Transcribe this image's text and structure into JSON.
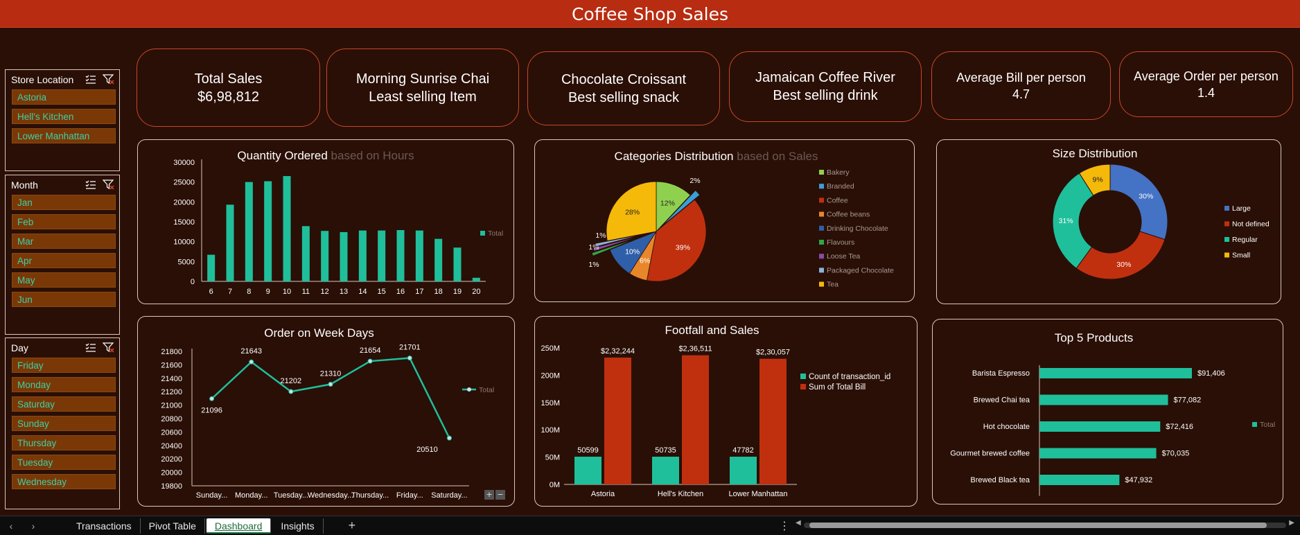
{
  "title": "Coffee Shop Sales",
  "slicers": {
    "store": {
      "label": "Store Location",
      "items": [
        "Astoria",
        "Hell's Kitchen",
        "Lower Manhattan"
      ]
    },
    "month": {
      "label": "Month",
      "items": [
        "Jan",
        "Feb",
        "Mar",
        "Apr",
        "May",
        "Jun"
      ]
    },
    "day": {
      "label": "Day",
      "items": [
        "Friday",
        "Monday",
        "Saturday",
        "Sunday",
        "Thursday",
        "Tuesday",
        "Wednesday"
      ]
    }
  },
  "kpis": {
    "total_sales": {
      "line1": "Total Sales",
      "line2": "$6,98,812"
    },
    "least_item": {
      "line1": "Morning Sunrise Chai",
      "line2": "Least selling Item"
    },
    "best_snack": {
      "line1": "Chocolate Croissant",
      "line2": "Best selling snack"
    },
    "best_drink": {
      "line1": "Jamaican Coffee River",
      "line2": "Best selling drink"
    },
    "avg_bill": {
      "line1": "Average Bill per person",
      "line2": "4.7"
    },
    "avg_order": {
      "line1": "Average Order per person",
      "line2": "1.4"
    }
  },
  "colors": {
    "teal": "#1fbf9b",
    "red": "#c0300f",
    "bg": "#2a0f06",
    "header": "#b82c11"
  },
  "chart_data": [
    {
      "id": "qty_hours",
      "type": "bar",
      "title": "Quantity Ordered",
      "subtitle": "based on Hours",
      "categories": [
        "6",
        "7",
        "8",
        "9",
        "10",
        "11",
        "12",
        "13",
        "14",
        "15",
        "16",
        "17",
        "18",
        "19",
        "20"
      ],
      "series": [
        {
          "name": "Total",
          "values": [
            6700,
            19300,
            25000,
            25200,
            26500,
            13900,
            12700,
            12400,
            12800,
            12800,
            12900,
            12800,
            10700,
            8500,
            900
          ]
        }
      ],
      "yticks": [
        "30000",
        "25000",
        "20000",
        "15000",
        "10000",
        "5000",
        "0"
      ],
      "ylim": [
        0,
        30000
      ],
      "legend": "right"
    },
    {
      "id": "categories",
      "type": "pie",
      "title": "Categories Distribution",
      "subtitle": "based on Sales",
      "slices": [
        {
          "name": "Bakery",
          "value": 12,
          "label": "12%",
          "color": "#8fd14f"
        },
        {
          "name": "Branded",
          "value": 2,
          "label": "2%",
          "color": "#3aa0d8"
        },
        {
          "name": "Coffee",
          "value": 39,
          "label": "39%",
          "color": "#c0300f"
        },
        {
          "name": "Coffee beans",
          "value": 6,
          "label": "6%",
          "color": "#e8862a"
        },
        {
          "name": "Drinking Chocolate",
          "value": 10,
          "label": "10%",
          "color": "#2f5fa8"
        },
        {
          "name": "Flavours",
          "value": 1,
          "label": "1%",
          "color": "#2ea84a"
        },
        {
          "name": "Loose Tea",
          "value": 1,
          "label": "1%",
          "color": "#8a4aa8"
        },
        {
          "name": "Packaged Chocolate",
          "value": 1,
          "label": "1%",
          "color": "#8ab4d8"
        },
        {
          "name": "Tea",
          "value": 28,
          "label": "28%",
          "color": "#f5b90a"
        }
      ],
      "legend": "right"
    },
    {
      "id": "size",
      "type": "pie",
      "title": "Size Distribution",
      "slices": [
        {
          "name": "Large",
          "value": 30,
          "label": "30%",
          "color": "#4472c4"
        },
        {
          "name": "Not defined",
          "value": 30,
          "label": "30%",
          "color": "#c0300f"
        },
        {
          "name": "Regular",
          "value": 31,
          "label": "31%",
          "color": "#1fbf9b"
        },
        {
          "name": "Small",
          "value": 9,
          "label": "9%",
          "color": "#f5b90a"
        }
      ],
      "legend": "right"
    },
    {
      "id": "weekdays",
      "type": "line",
      "title": "Order on Week Days",
      "categories": [
        "Sunday...",
        "Monday...",
        "Tuesday...",
        "Wednesday...",
        "Thursday...",
        "Friday...",
        "Saturday..."
      ],
      "series": [
        {
          "name": "Total",
          "values": [
            21096,
            21643,
            21202,
            21310,
            21654,
            21701,
            20510
          ]
        }
      ],
      "yticks": [
        "21800",
        "21600",
        "21400",
        "21200",
        "21000",
        "20800",
        "20600",
        "20400",
        "20200",
        "20000",
        "19800"
      ],
      "ylim": [
        19800,
        21800
      ],
      "legend": "right"
    },
    {
      "id": "footfall",
      "type": "bar",
      "title": "Footfall and Sales",
      "categories": [
        "Astoria",
        "Hell's Kitchen",
        "Lower Manhattan"
      ],
      "series": [
        {
          "name": "Count of transaction_id",
          "values": [
            50599,
            50735,
            47782
          ],
          "labels": [
            "50599",
            "50735",
            "47782"
          ],
          "color": "#1fbf9b"
        },
        {
          "name": "Sum of Total Bill",
          "values": [
            232244,
            236511,
            230057
          ],
          "labels": [
            "$2,32,244",
            "$2,36,511",
            "$2,30,057"
          ],
          "color": "#c0300f"
        }
      ],
      "yticks": [
        "250M",
        "200M",
        "150M",
        "100M",
        "50M",
        "0M"
      ],
      "legend": "right"
    },
    {
      "id": "top5",
      "type": "bar",
      "title": "Top 5 Products",
      "categories": [
        "Barista Espresso",
        "Brewed Chai tea",
        "Hot chocolate",
        "Gourmet brewed coffee",
        "Brewed Black tea"
      ],
      "series": [
        {
          "name": "Total",
          "values": [
            91406,
            77082,
            72416,
            70035,
            47932
          ],
          "labels": [
            "$91,406",
            "$77,082",
            "$72,416",
            "$70,035",
            "$47,932"
          ]
        }
      ],
      "legend": "right"
    }
  ],
  "sheets": {
    "tabs": [
      "Transactions",
      "Pivot Table",
      "Dashboard",
      "Insights"
    ],
    "active": "Dashboard"
  }
}
